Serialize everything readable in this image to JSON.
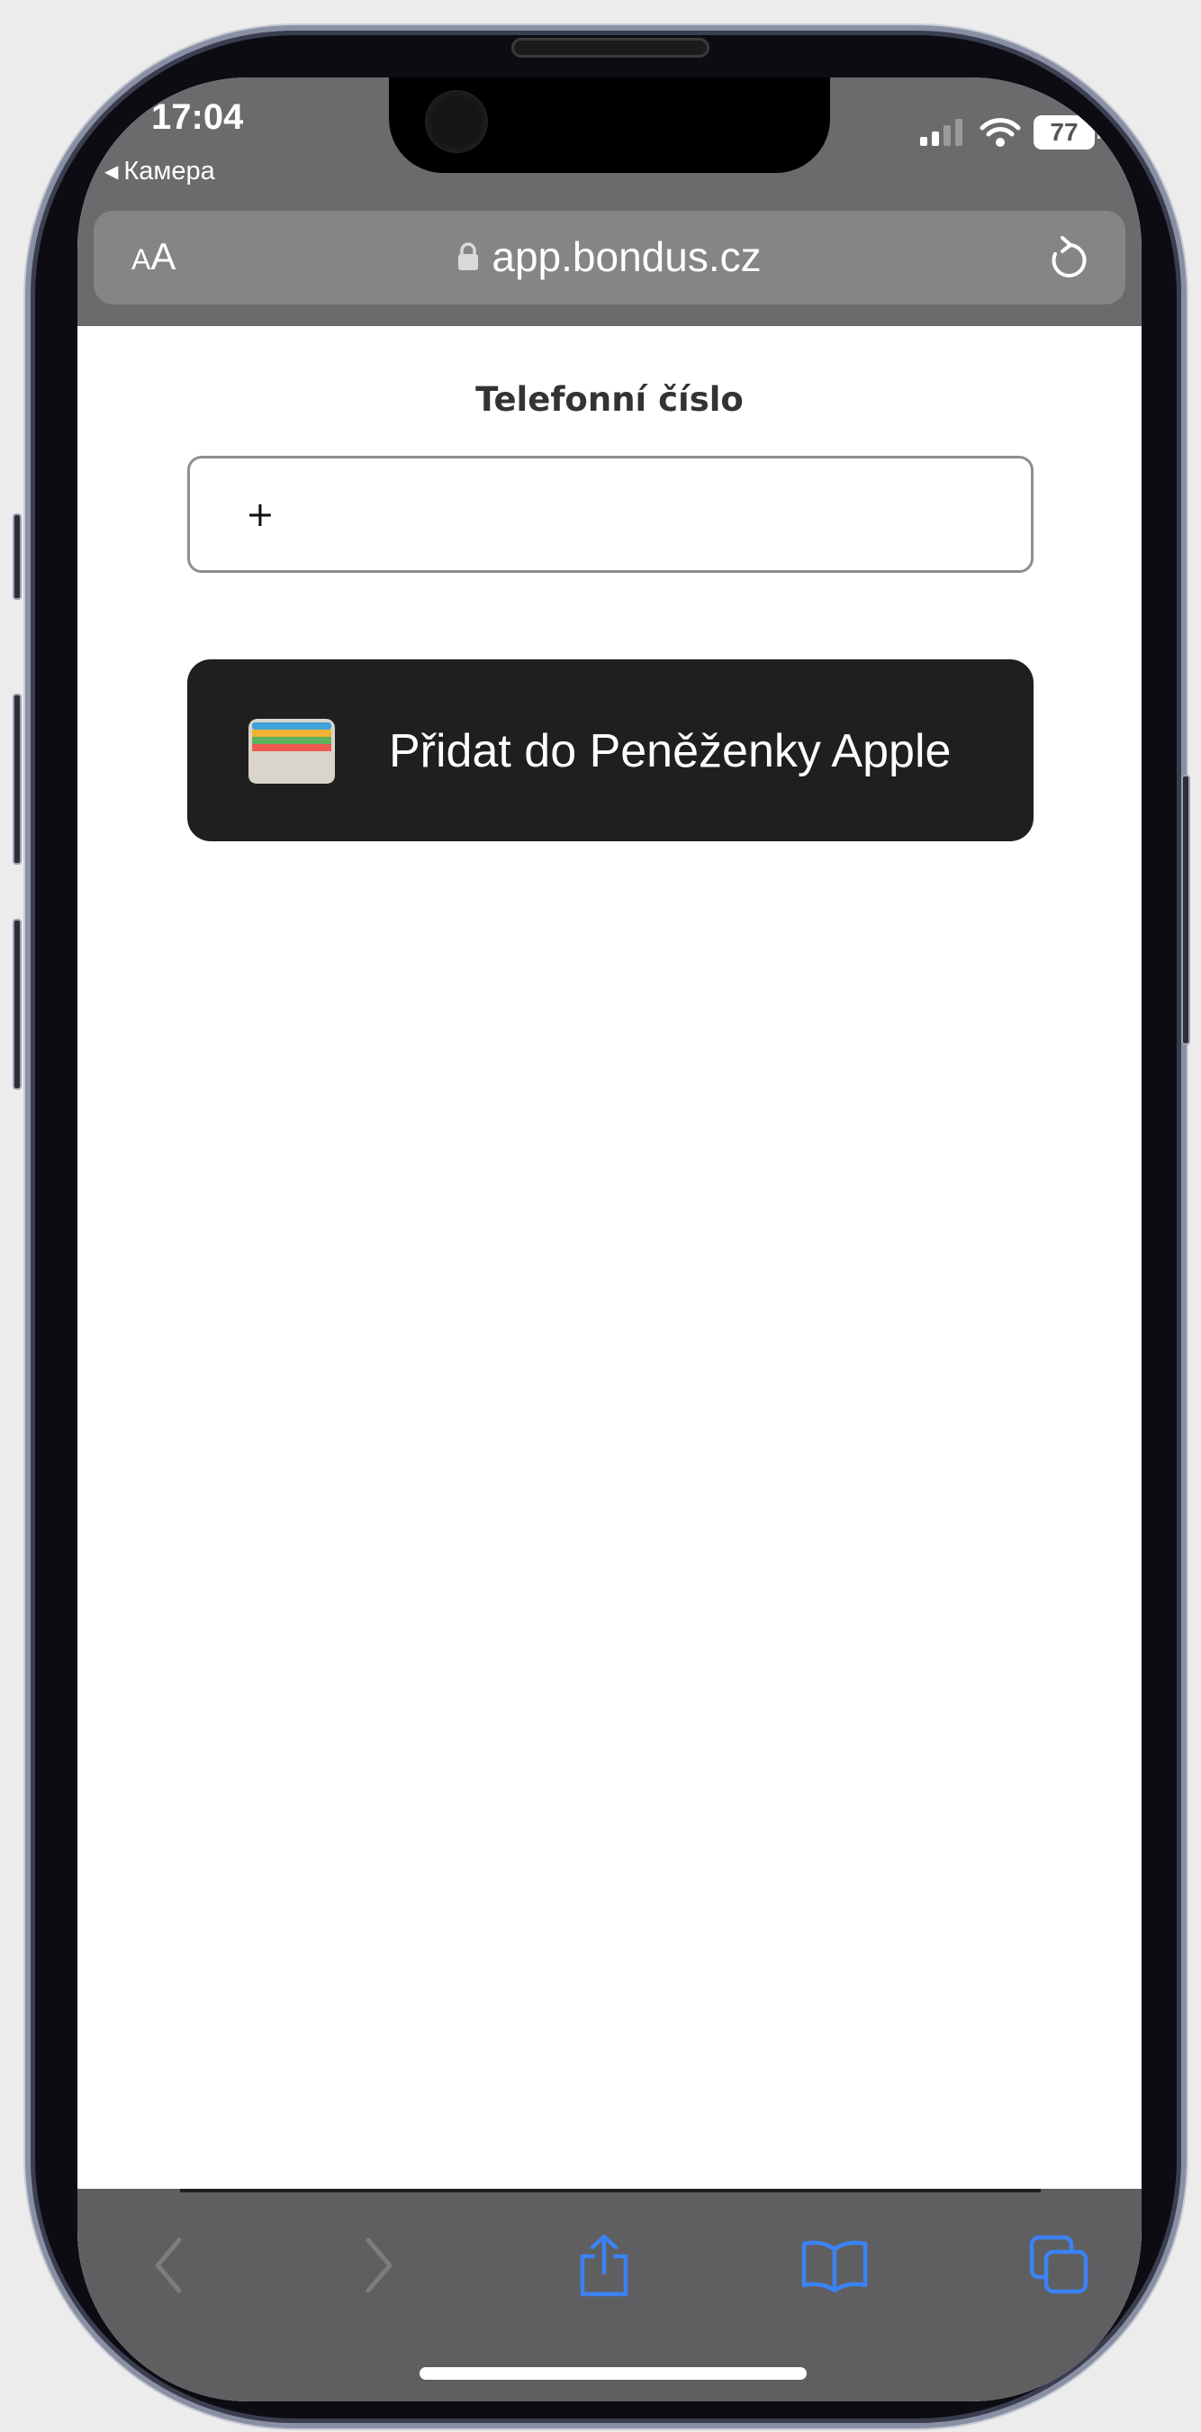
{
  "status_bar": {
    "time": "17:04",
    "back_app_label": "Камера",
    "battery_level": "77",
    "signal_icon": "cellular-signal-icon",
    "wifi_icon": "wifi-icon"
  },
  "browser": {
    "text_size_small": "A",
    "text_size_large": "A",
    "url": "app.bondus.cz",
    "lock_icon": "lock-icon",
    "reload_icon": "reload-icon"
  },
  "form": {
    "phone_label": "Telefonní číslo",
    "phone_value": "+",
    "wallet_button_label": "Přidat do Peněženky Apple",
    "wallet_icon": "apple-wallet-icon"
  },
  "toolbar": {
    "back_icon": "chevron-left-icon",
    "forward_icon": "chevron-right-icon",
    "share_icon": "share-icon",
    "bookmarks_icon": "book-icon",
    "tabs_icon": "tabs-icon",
    "accent_color": "#3b82f6",
    "disabled_color": "#7d7d80"
  }
}
